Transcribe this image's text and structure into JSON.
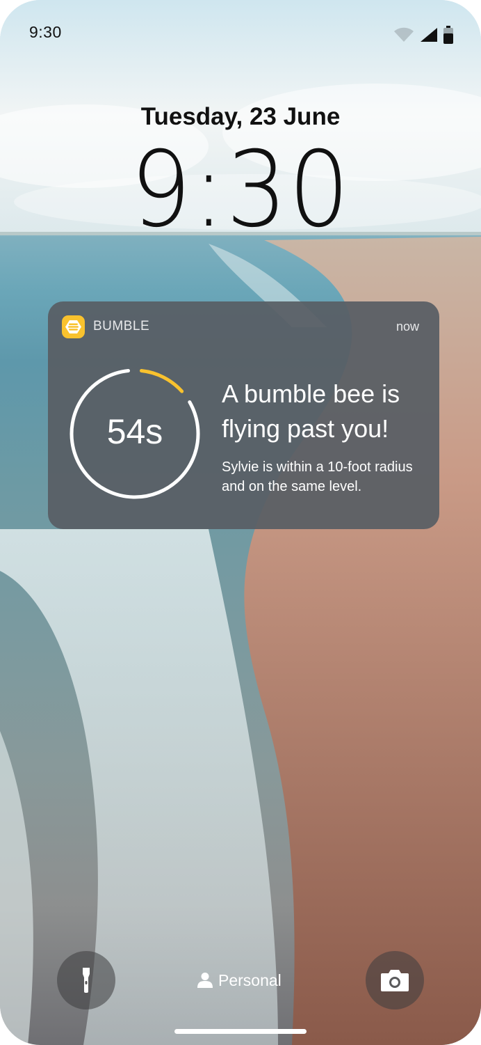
{
  "status_bar": {
    "time": "9:30",
    "icons": [
      "wifi-icon",
      "cellular-signal-icon",
      "battery-icon"
    ]
  },
  "lock_screen": {
    "date": "Tuesday,  23 June",
    "clock": "9:30"
  },
  "notification": {
    "app_name": "BUMBLE",
    "time": "now",
    "timer_label": "54s",
    "timer_remaining_fraction": 0.15,
    "title": "A bumble bee is flying past you!",
    "body": "Sylvie is within a 10-foot radius and on the same level.",
    "colors": {
      "accent": "#f9c22e",
      "card": "#585e64"
    }
  },
  "bottom": {
    "profile_label": "Personal",
    "left_button_icon": "flashlight-icon",
    "right_button_icon": "camera-icon"
  }
}
